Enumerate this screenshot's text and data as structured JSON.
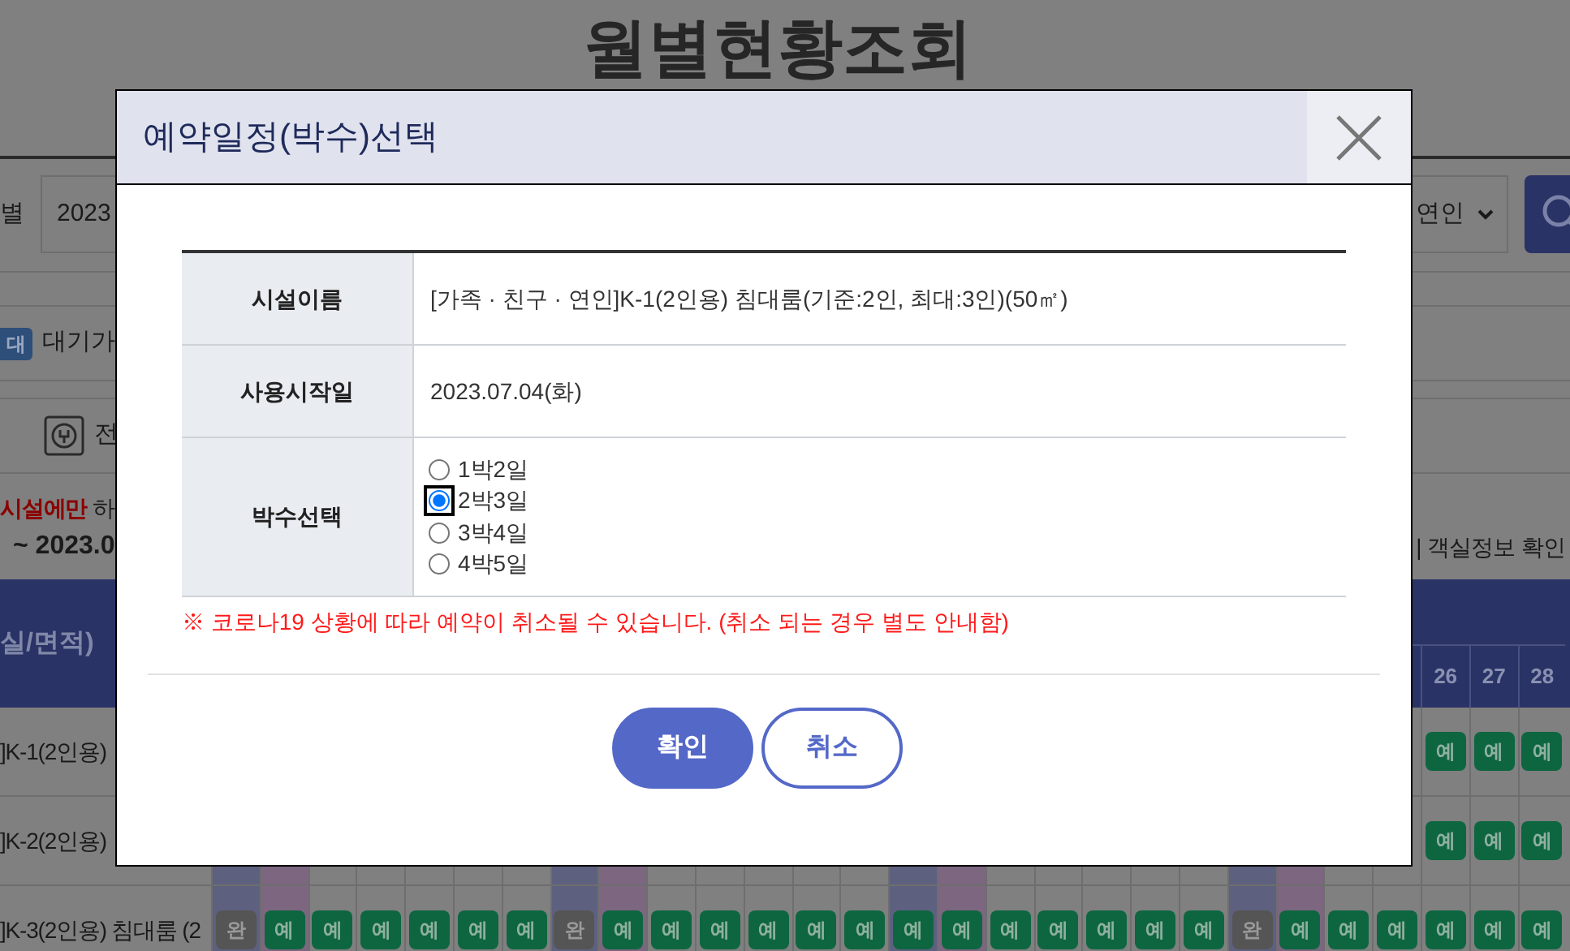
{
  "page": {
    "title": "월별현황조회",
    "search": {
      "label": "별",
      "year_field": "2023",
      "type_select": "연인"
    },
    "legend": {
      "badge": "대",
      "text": "대기가"
    },
    "tab": {
      "label": "전"
    },
    "notice": {
      "highlight": "시설에만",
      "rest": "하"
    },
    "period": "~ 2023.0",
    "room_info_link": "| 객실정보 확인",
    "table": {
      "header": "실/면적)",
      "columns": [
        {
          "kind": "shaded"
        },
        {
          "kind": "tinted"
        },
        {
          "kind": "plain"
        },
        {
          "kind": "plain"
        },
        {
          "kind": "plain"
        },
        {
          "kind": "plain"
        },
        {
          "kind": "plain"
        },
        {
          "kind": "shaded"
        },
        {
          "kind": "tinted"
        },
        {
          "kind": "plain"
        },
        {
          "kind": "plain"
        },
        {
          "kind": "plain"
        },
        {
          "kind": "plain"
        },
        {
          "kind": "plain"
        },
        {
          "kind": "shaded"
        },
        {
          "kind": "tinted"
        },
        {
          "kind": "plain"
        },
        {
          "kind": "plain"
        },
        {
          "kind": "plain"
        },
        {
          "kind": "plain"
        },
        {
          "kind": "plain"
        },
        {
          "kind": "shaded"
        },
        {
          "kind": "tinted"
        },
        {
          "kind": "plain"
        },
        {
          "kind": "plain"
        },
        {
          "kind": "plain"
        },
        {
          "kind": "plain"
        },
        {
          "kind": "plain"
        }
      ],
      "dates": [
        "26",
        "27",
        "28"
      ],
      "rows": [
        {
          "name": "]K-1(2인용)",
          "cells": [
            {
              "label": "예",
              "kind": "open"
            },
            {
              "label": "예",
              "kind": "open"
            },
            {
              "label": "예",
              "kind": "open"
            }
          ]
        },
        {
          "name": "]K-2(2인용)",
          "cells": [
            {
              "label": "예",
              "kind": "open"
            },
            {
              "label": "예",
              "kind": "open"
            },
            {
              "label": "예",
              "kind": "open"
            }
          ]
        },
        {
          "name": "]K-3(2인용) 침대룸 (2",
          "cells": [
            {
              "label": "완",
              "kind": "done"
            },
            {
              "label": "예",
              "kind": "open"
            },
            {
              "label": "예",
              "kind": "open"
            },
            {
              "label": "예",
              "kind": "open"
            },
            {
              "label": "예",
              "kind": "open"
            },
            {
              "label": "예",
              "kind": "open"
            },
            {
              "label": "예",
              "kind": "open"
            },
            {
              "label": "완",
              "kind": "done"
            },
            {
              "label": "예",
              "kind": "open"
            },
            {
              "label": "예",
              "kind": "open"
            },
            {
              "label": "예",
              "kind": "open"
            },
            {
              "label": "예",
              "kind": "open"
            },
            {
              "label": "예",
              "kind": "open"
            },
            {
              "label": "예",
              "kind": "open"
            },
            {
              "label": "예",
              "kind": "open"
            },
            {
              "label": "예",
              "kind": "open"
            },
            {
              "label": "예",
              "kind": "open"
            },
            {
              "label": "예",
              "kind": "open"
            },
            {
              "label": "예",
              "kind": "open"
            },
            {
              "label": "예",
              "kind": "open"
            },
            {
              "label": "예",
              "kind": "open"
            },
            {
              "label": "완",
              "kind": "done"
            },
            {
              "label": "예",
              "kind": "open"
            },
            {
              "label": "예",
              "kind": "open"
            },
            {
              "label": "예",
              "kind": "open"
            },
            {
              "label": "예",
              "kind": "open"
            },
            {
              "label": "예",
              "kind": "open"
            },
            {
              "label": "예",
              "kind": "open"
            }
          ]
        }
      ]
    }
  },
  "dialog": {
    "title": "예약일정(박수)선택",
    "fields": [
      {
        "label": "시설이름",
        "value": "[가족 · 친구 · 연인]K-1(2인용) 침대룸(기준:2인, 최대:3인)(50㎡)"
      },
      {
        "label": "사용시작일",
        "value": "2023.07.04(화)"
      }
    ],
    "nights": {
      "label": "박수선택",
      "options": [
        {
          "label": "1박2일",
          "selected": false
        },
        {
          "label": "2박3일",
          "selected": true
        },
        {
          "label": "3박4일",
          "selected": false
        },
        {
          "label": "4박5일",
          "selected": false
        }
      ]
    },
    "notice": "※ 코로나19 상황에 따라 예약이 취소될 수 있습니다. (취소 되는 경우 별도 안내함)",
    "buttons": [
      {
        "label": "확인",
        "kind": "primary"
      },
      {
        "label": "취소",
        "kind": "secondary"
      }
    ]
  }
}
